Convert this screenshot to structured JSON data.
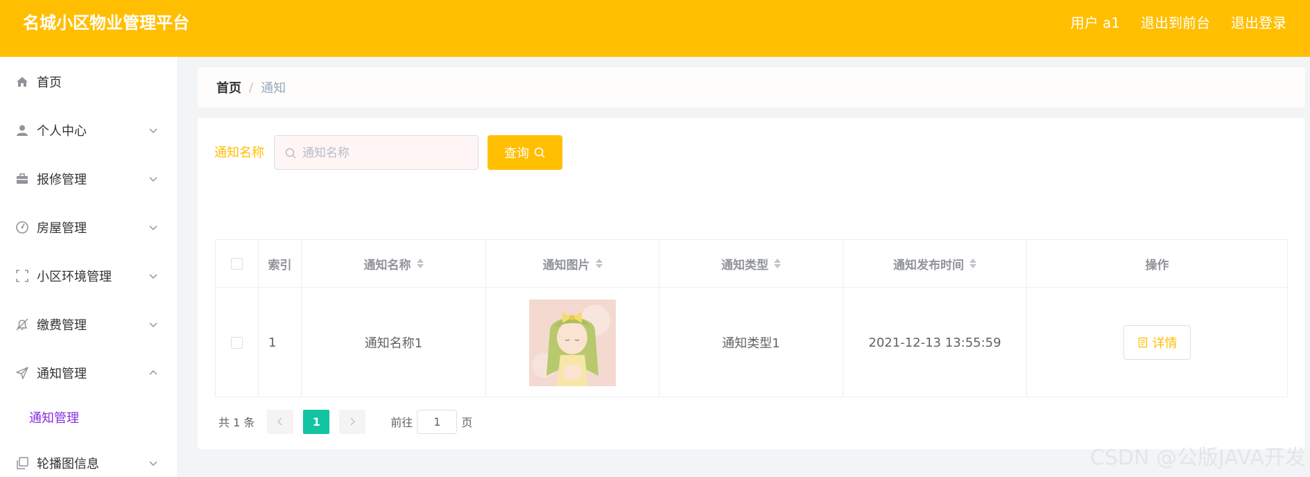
{
  "header": {
    "title": "名城小区物业管理平台",
    "user": "用户 a1",
    "exit_front": "退出到前台",
    "logout": "退出登录"
  },
  "sidebar": {
    "items": [
      {
        "label": "首页",
        "icon": "home-icon"
      },
      {
        "label": "个人中心",
        "icon": "user-icon"
      },
      {
        "label": "报修管理",
        "icon": "briefcase-icon"
      },
      {
        "label": "房屋管理",
        "icon": "dashboard-icon"
      },
      {
        "label": "小区环境管理",
        "icon": "fullscreen-icon"
      },
      {
        "label": "缴费管理",
        "icon": "bell-off-icon"
      },
      {
        "label": "通知管理",
        "icon": "send-icon"
      },
      {
        "label": "轮播图信息",
        "icon": "copy-icon"
      }
    ],
    "sub_item": "通知管理"
  },
  "breadcrumb": {
    "home": "首页",
    "separator": "/",
    "current": "通知"
  },
  "search": {
    "label": "通知名称",
    "placeholder": "通知名称",
    "value": "",
    "button": "查询"
  },
  "table": {
    "columns": [
      "索引",
      "通知名称",
      "通知图片",
      "通知类型",
      "通知发布时间",
      "操作"
    ],
    "rows": [
      {
        "index": "1",
        "name": "通知名称1",
        "type": "通知类型1",
        "time": "2021-12-13 13:55:59",
        "action": "详情"
      }
    ]
  },
  "pagination": {
    "total": "共 1 条",
    "current": "1",
    "goto_label": "前往",
    "goto_value": "1",
    "page_suffix": "页"
  },
  "watermark": "CSDN @公版JAVA开发",
  "colors": {
    "primary": "#ffbf00",
    "accent_purple": "#8a2be2",
    "pager_active": "#13c4a3"
  }
}
